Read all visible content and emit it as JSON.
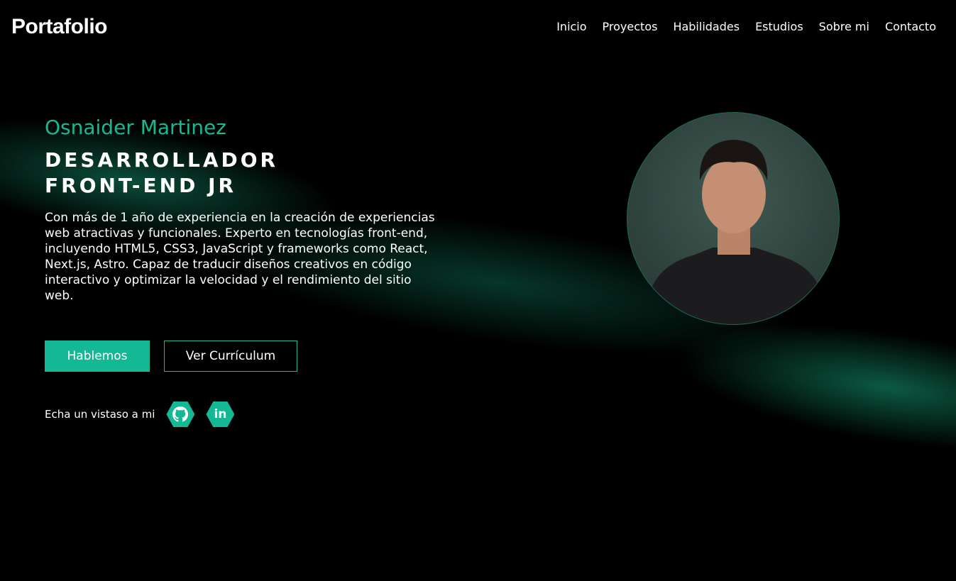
{
  "header": {
    "logo": "Portafolio",
    "nav": [
      "Inicio",
      "Proyectos",
      "Habilidades",
      "Estudios",
      "Sobre mi",
      "Contacto"
    ]
  },
  "hero": {
    "name": "Osnaider Martinez",
    "role_line1": "DESARROLLADOR",
    "role_line2": "FRONT-END JR",
    "description": "Con más de 1 año de experiencia en la creación de experiencias web atractivas y funcionales. Experto en tecnologías front-end, incluyendo HTML5, CSS3, JavaScript y frameworks como React, Next.js, Astro. Capaz de traducir diseños creativos en código interactivo y optimizar la velocidad y el rendimiento del sitio web.",
    "primary_button": "Hablemos",
    "secondary_button": "Ver Currículum",
    "social_label": "Echa un vistaso a mi",
    "social_icons": [
      "github-icon",
      "linkedin-icon"
    ],
    "linkedin_text": "in"
  },
  "colors": {
    "accent": "#14b894",
    "background": "#000000"
  }
}
